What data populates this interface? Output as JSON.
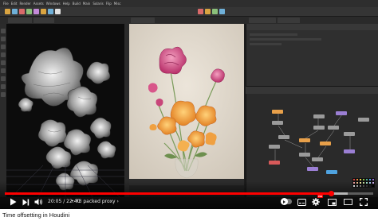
{
  "houdini": {
    "menu_items": [
      "File",
      "Edit",
      "Render",
      "Assets",
      "Windows",
      "Help",
      "Build",
      "Main",
      "Solaris",
      "Flip",
      "Misc"
    ],
    "shelf_icon_colors": [
      "#d9a441",
      "#6fb0d8",
      "#d96a6a",
      "#8bc07a",
      "#c48ad8",
      "#d9a441",
      "#6fb0d8",
      "#e0e0e0",
      "#d96a6a",
      "#d9a441",
      "#8bc07a",
      "#6fb0d8"
    ],
    "network_node_colors": {
      "default": "#9a9a9a",
      "orange": "#e8a04a",
      "purple": "#9b7fd4",
      "red": "#d85a5a",
      "display": "#4fa3e0"
    },
    "palette_colors": [
      "#d94040",
      "#e88a3c",
      "#e8d24a",
      "#8bc34a",
      "#4caf8a",
      "#4a9ee8",
      "#9b6fd4",
      "#f0a0a0",
      "#f0c090",
      "#f0e6a0",
      "#c4e0a0",
      "#a0e0c8",
      "#a0c8f0",
      "#d0b0f0",
      "#ffffff",
      "#c0c0c0",
      "#909090",
      "#606060",
      "#404040",
      "#202020",
      "#000000"
    ]
  },
  "player": {
    "time_display": "20:05 / 22:40",
    "separator": "•",
    "chapter": "R3 packed proxy",
    "chapter_chevron": "›",
    "progress": {
      "played": 0.886,
      "loaded": 0.93
    },
    "hd_badge": "HD",
    "accent_color": "#ff0000",
    "icons": [
      "play-icon",
      "next-icon",
      "volume-icon",
      "autoplay-toggle",
      "subtitles-icon",
      "settings-icon",
      "miniplayer-icon",
      "theater-icon",
      "fullscreen-icon"
    ]
  },
  "video_title": "Time offsetting in Houdini"
}
